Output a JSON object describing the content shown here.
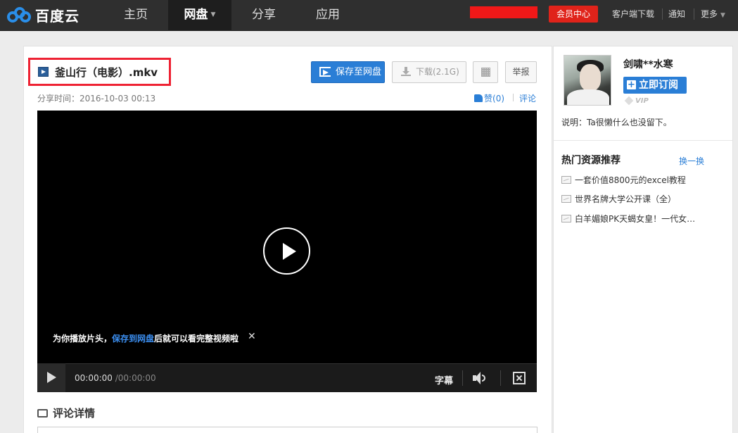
{
  "nav": {
    "logo_text": "百度云",
    "items": [
      {
        "label": "主页"
      },
      {
        "label": "网盘",
        "active": true
      },
      {
        "label": "分享"
      },
      {
        "label": "应用"
      }
    ],
    "vip_center": "会员中心",
    "client_download": "客户端下载",
    "notify": "通知",
    "more": "更多"
  },
  "file": {
    "title": "釜山行（电影）.mkv",
    "share_time": "分享时间：2016-10-03 00:13",
    "save_label": "保存至网盘",
    "download_label": "下载(2.1G)",
    "report_label": "举报",
    "like_label": "赞",
    "like_count": "(0)",
    "comment_link": "评论"
  },
  "player": {
    "promo_prefix": "为你播放片头，",
    "promo_link": "保存到网盘",
    "promo_suffix": "后就可以看完整视频啦",
    "promo_close": "✕",
    "current_time": "00:00:00",
    "duration": "/00:00:00",
    "subtitle_label": "字幕"
  },
  "comments": {
    "heading": "评论详情"
  },
  "sidebar": {
    "user_name": "剑啸**水寒",
    "subscribe_label": "立即订阅",
    "vip_label": "VIP",
    "description": "说明：Ta很懒什么也没留下。",
    "hot_title": "热门资源推荐",
    "hot_refresh": "换一换",
    "hot_items": [
      {
        "label": "一套价值8800元的excel教程"
      },
      {
        "label": "世界名牌大学公开课（全）"
      },
      {
        "label": "白羊媚娘PK天蝎女皇！一代女皇…"
      }
    ]
  },
  "colors": {
    "accent": "#2a7ed6",
    "vip_red": "#e0231a",
    "highlight_box": "#ee2233"
  }
}
